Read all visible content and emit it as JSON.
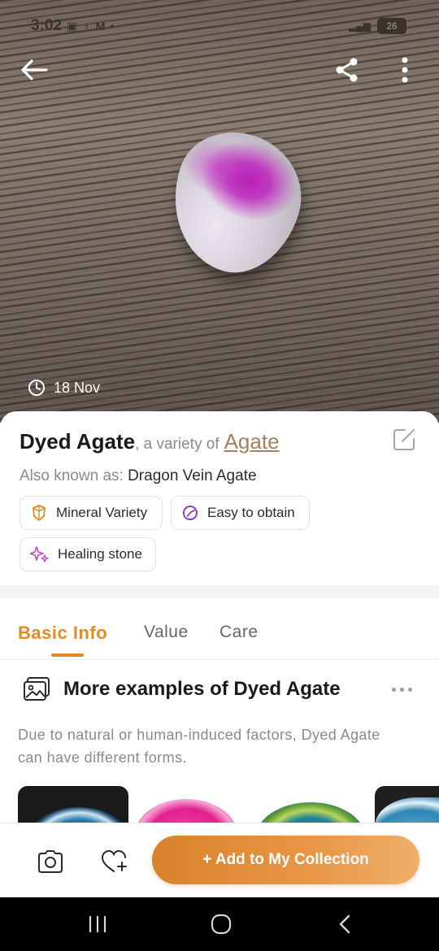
{
  "status_bar": {
    "time": "3:02",
    "battery": "26"
  },
  "photo": {
    "date": "18 Nov"
  },
  "info": {
    "title": "Dyed Agate",
    "variety_prefix": ", a variety of ",
    "variety_link": "Agate",
    "aka_label": "Also known as: ",
    "aka_value": "Dragon Vein Agate",
    "tags": [
      {
        "label": "Mineral Variety",
        "icon": "mineral-icon"
      },
      {
        "label": "Easy to obtain",
        "icon": "obtain-icon"
      },
      {
        "label": "Healing stone",
        "icon": "sparkle-icon"
      }
    ]
  },
  "tabs": [
    {
      "label": "Basic Info",
      "active": true
    },
    {
      "label": "Value",
      "active": false
    },
    {
      "label": "Care",
      "active": false
    }
  ],
  "examples": {
    "title": "More examples of Dyed Agate",
    "description": "Due to natural or human-induced factors, Dyed Agate can have different forms."
  },
  "actions": {
    "add_label": "+ Add to My Collection"
  },
  "colors": {
    "accent": "#e58a22",
    "link": "#a67f5d"
  }
}
